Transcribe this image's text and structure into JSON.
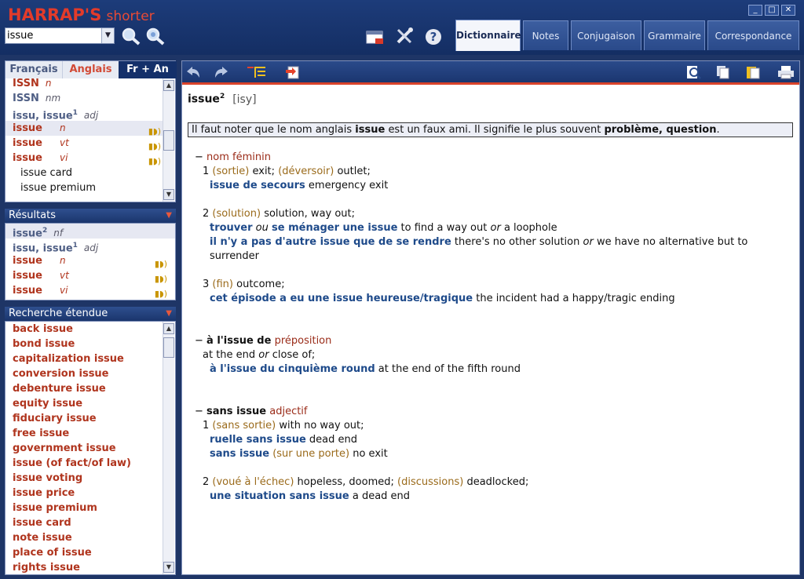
{
  "app": {
    "logo_main": "HARRAP'S",
    "logo_sub": "shorter",
    "search_value": "issue"
  },
  "tabs": [
    "Dictionnaire",
    "Notes",
    "Conjugaison",
    "Grammaire",
    "Correspondance"
  ],
  "lang_tabs": [
    "Français",
    "Anglais",
    "Fr + An"
  ],
  "index_list": [
    {
      "word": "ISSN",
      "pos": "n",
      "style": "hw"
    },
    {
      "word": "ISSN",
      "pos": "nm",
      "style": "grey"
    },
    {
      "word": "issu, issue",
      "sup": "1",
      "pos": "adj",
      "style": "grey"
    },
    {
      "word": "issue",
      "pos": "n",
      "style": "hw",
      "sound": true,
      "selected": true
    },
    {
      "word": "issue",
      "pos": "vt",
      "style": "hw",
      "sound": true
    },
    {
      "word": "issue",
      "pos": "vi",
      "style": "hw",
      "sound": true
    },
    {
      "word": "issue card",
      "style": "comp"
    },
    {
      "word": "issue premium",
      "style": "comp"
    }
  ],
  "results": {
    "title": "Résultats",
    "items": [
      {
        "word": "issue",
        "sup": "2",
        "pos": "nf",
        "style": "grey",
        "selected": true
      },
      {
        "word": "issu, issue",
        "sup": "1",
        "pos": "adj",
        "style": "grey"
      },
      {
        "word": "issue",
        "pos": "n",
        "style": "hw",
        "sound": true
      },
      {
        "word": "issue",
        "pos": "vt",
        "style": "hw",
        "sound": true
      },
      {
        "word": "issue",
        "pos": "vi",
        "style": "hw",
        "sound": true
      }
    ]
  },
  "extended": {
    "title": "Recherche étendue",
    "items": [
      "back issue",
      "bond issue",
      "capitalization issue",
      "conversion issue",
      "debenture issue",
      "equity issue",
      "fiduciary issue",
      "free issue",
      "government issue",
      "issue (of fact/of law)",
      "issue voting",
      "issue price",
      "issue premium",
      "issue card",
      "note issue",
      "place of issue",
      "rights issue"
    ]
  },
  "entry": {
    "headword": "issue",
    "sup": "2",
    "phonetic": "[isy]",
    "note_prefix": "Il faut noter que le nom anglais",
    "note_word": "issue",
    "note_mid": "est un faux ami. Il signifie le plus souvent",
    "note_meaning": "problème, question",
    "note_end": ".",
    "pos1": "nom féminin",
    "s1_num": "1",
    "s1_g1": "(sortie)",
    "s1_t1": "exit;",
    "s1_g2": "(déversoir)",
    "s1_t2": "outlet;",
    "s1_ex1": "issue de secours",
    "s1_ex1_tr": "emergency exit",
    "s2_num": "2",
    "s2_g": "(solution)",
    "s2_t": "solution, way out;",
    "s2_ex1a": "trouver",
    "s2_ex1_ou": "ou",
    "s2_ex1b": "se ménager une issue",
    "s2_ex1_tr1": "to find a way out",
    "s2_ex1_or": "or",
    "s2_ex1_tr2": "a loophole",
    "s2_ex2": "il n'y a pas d'autre issue que de se rendre",
    "s2_ex2_tr1": "there's no other solution",
    "s2_ex2_or": "or",
    "s2_ex2_tr2": "we have no alternative but to",
    "s2_ex2_tr3": "surrender",
    "s3_num": "3",
    "s3_g": "(fin)",
    "s3_t": "outcome;",
    "s3_ex": "cet épisode a eu une issue heureuse/tragique",
    "s3_ex_tr": "the incident had a happy/tragic ending",
    "prep_head": "à l'issue de",
    "prep_pos": "préposition",
    "prep_t1": "at the end",
    "prep_or": "or",
    "prep_t2": "close of;",
    "prep_ex": "à l'issue du cinquième round",
    "prep_ex_tr": "at the end of the fifth round",
    "adj_head": "sans issue",
    "adj_pos": "adjectif",
    "a1_num": "1",
    "a1_g": "(sans sortie)",
    "a1_t": "with no way out;",
    "a1_ex1": "ruelle sans issue",
    "a1_ex1_tr": "dead end",
    "a1_ex2": "sans issue",
    "a1_ex2_g": "(sur une porte)",
    "a1_ex2_tr": "no exit",
    "a2_num": "2",
    "a2_g1": "(voué à l'échec)",
    "a2_t1": "hopeless, doomed;",
    "a2_g2": "(discussions)",
    "a2_t2": "deadlocked;",
    "a2_ex": "une situation sans issue",
    "a2_ex_tr": "a dead end"
  }
}
